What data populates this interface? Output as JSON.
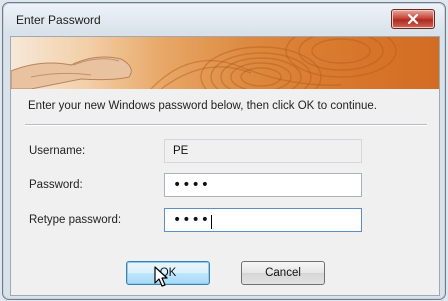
{
  "window": {
    "title": "Enter Password"
  },
  "dialog": {
    "instruction": "Enter your new Windows password below, then click OK to continue.",
    "username_label": "Username:",
    "username_value": "PE",
    "password_label": "Password:",
    "password_value": "••••",
    "retype_label": "Retype password:",
    "retype_value": "••••"
  },
  "buttons": {
    "ok_label": "OK",
    "cancel_label": "Cancel"
  },
  "icons": {
    "close": "close-icon",
    "cursor": "mouse-pointer-icon",
    "banner": "fingerprint-banner"
  }
}
